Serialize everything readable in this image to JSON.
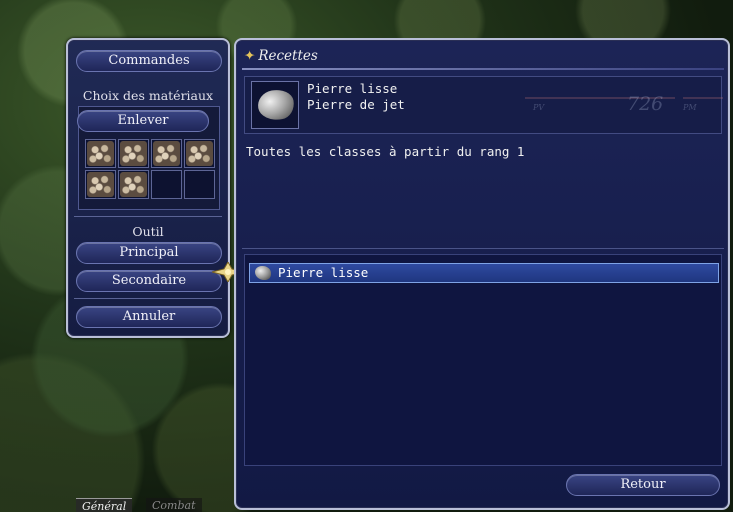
{
  "left_panel": {
    "commandes_label": "Commandes",
    "materials_title": "Choix des matériaux",
    "enlever_label": "Enlever",
    "material_slots": [
      {
        "filled": true
      },
      {
        "filled": true
      },
      {
        "filled": true
      },
      {
        "filled": true
      },
      {
        "filled": true
      },
      {
        "filled": true
      },
      {
        "filled": false
      },
      {
        "filled": false
      }
    ],
    "tool_title": "Outil",
    "principal_label": "Principal",
    "secondaire_label": "Secondaire",
    "annuler_label": "Annuler"
  },
  "recipe_panel": {
    "title": "Recettes",
    "item_name": "Pierre lisse",
    "item_subtitle": "Pierre de jet",
    "requirement": "Toutes les classes à partir du rang 1",
    "recipes": [
      {
        "label": "Pierre lisse",
        "selected": true
      }
    ],
    "retour_label": "Retour"
  },
  "hud_ghost": {
    "pv_label": "PV",
    "hp_value": "726",
    "pm_label": "PM"
  },
  "chat_tabs": {
    "general": "Général",
    "combat": "Combat"
  },
  "colors": {
    "panel_bg": "#1c2456",
    "button_bg": "#3a4584",
    "selection": "#2f4aa0",
    "border": "#b9bfd8",
    "accent_star": "#e5c45a"
  }
}
